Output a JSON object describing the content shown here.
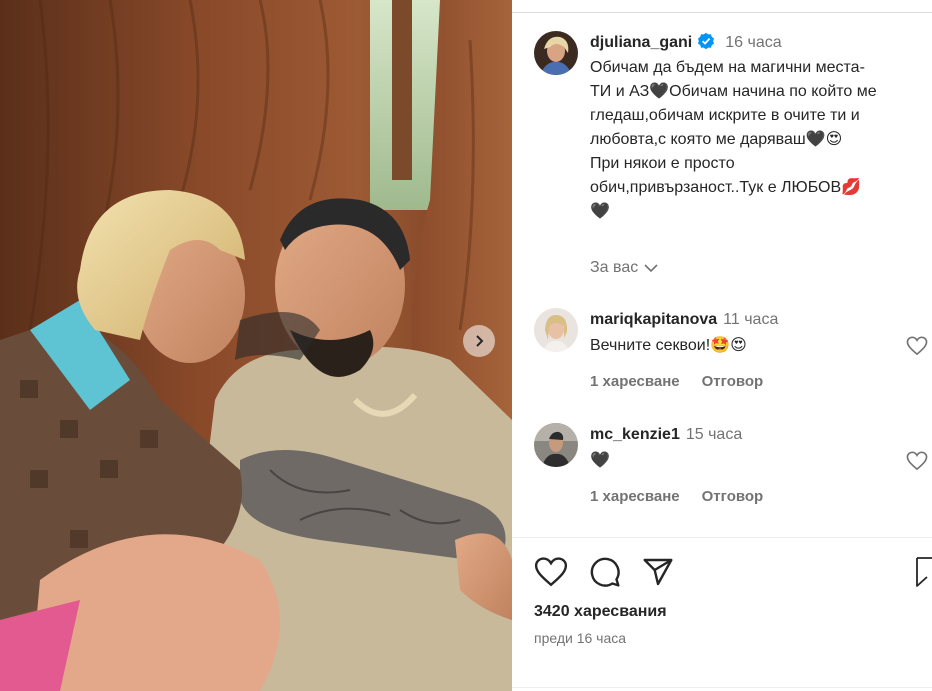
{
  "post": {
    "author": "djuliana_gani",
    "time_ago": "16 часа",
    "caption_lines": [
      "Обичам да бъдем на магични места-",
      "ТИ и АЗ🖤Обичам начина по който ме",
      "гледаш,обичам искрите в очите ти и",
      "любовта,с която ме даряваш🖤😍",
      "При някои е просто",
      "обич,привързаност..Тук е ЛЮБОВ💋",
      "🖤"
    ],
    "translate_label": "За вас",
    "likes_count": "3420 харесвания",
    "posted_ago": "преди 16 часа"
  },
  "comments": [
    {
      "user": "mariqkapitanova",
      "time_ago": "11 часа",
      "text": "Вечните секвои!🤩😍",
      "likes": "1 харесване",
      "reply_label": "Отговор"
    },
    {
      "user": "mc_kenzie1",
      "time_ago": "15 часа",
      "text": "🖤",
      "likes": "1 харесване",
      "reply_label": "Отговор"
    }
  ],
  "icons": {
    "verified": "verified-badge-icon",
    "like": "heart-outline-icon",
    "comment": "speech-bubble-icon",
    "share": "paper-plane-icon",
    "save": "bookmark-icon",
    "next": "chevron-right-icon",
    "translate_toggle": "chevron-down-icon"
  },
  "colors": {
    "text_primary": "#262626",
    "text_secondary": "#737373",
    "verified_blue": "#0095f6",
    "divider": "#dbdbdb"
  }
}
